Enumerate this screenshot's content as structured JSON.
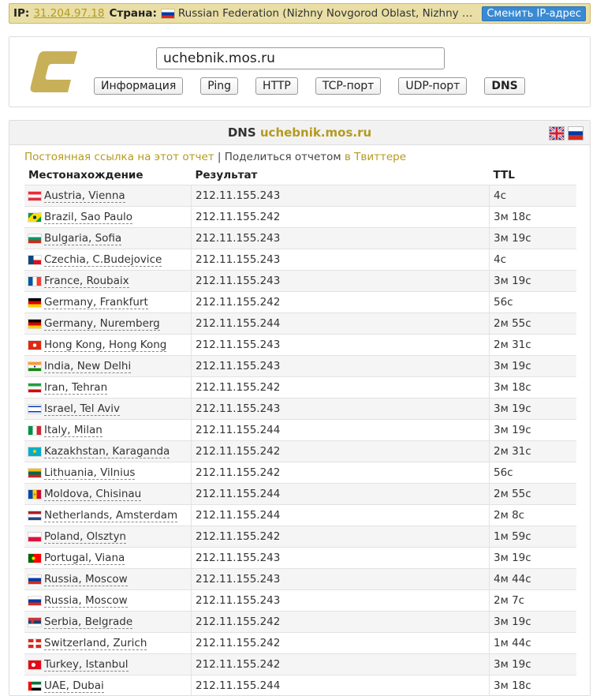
{
  "topbar": {
    "ip_label": "IP:",
    "ip": "31.204.97.18",
    "country_label": "Страна:",
    "country_flag": "ru",
    "location": "Russian Federation (Nizhny Novgorod Oblast, Nizhny Nov...",
    "change_ip_button": "Сменить IP-адрес"
  },
  "search": {
    "host": "uchebnik.mos.ru",
    "tabs": [
      "Информация",
      "Ping",
      "HTTP",
      "TCP-порт",
      "UDP-порт",
      "DNS"
    ],
    "active_tab": "DNS"
  },
  "results": {
    "title_prefix": "DNS",
    "host": "uchebnik.mos.ru",
    "permalink": "Постоянная ссылка на этот отчет",
    "separator": "|",
    "share": "Поделиться отчетом",
    "twitter": "в Твиттере",
    "columns": [
      "Местонахождение",
      "Результат",
      "TTL"
    ],
    "rows": [
      {
        "flag": "at",
        "location": "Austria, Vienna",
        "result": "212.11.155.243",
        "ttl": "4с"
      },
      {
        "flag": "br",
        "location": "Brazil, Sao Paulo",
        "result": "212.11.155.242",
        "ttl": "3м 18с"
      },
      {
        "flag": "bg",
        "location": "Bulgaria, Sofia",
        "result": "212.11.155.243",
        "ttl": "3м 19с"
      },
      {
        "flag": "cz",
        "location": "Czechia, C.Budejovice",
        "result": "212.11.155.243",
        "ttl": "4с"
      },
      {
        "flag": "fr",
        "location": "France, Roubaix",
        "result": "212.11.155.243",
        "ttl": "3м 19с"
      },
      {
        "flag": "de",
        "location": "Germany, Frankfurt",
        "result": "212.11.155.242",
        "ttl": "56с"
      },
      {
        "flag": "de",
        "location": "Germany, Nuremberg",
        "result": "212.11.155.244",
        "ttl": "2м 55с"
      },
      {
        "flag": "hk",
        "location": "Hong Kong, Hong Kong",
        "result": "212.11.155.243",
        "ttl": "2м 31с"
      },
      {
        "flag": "in",
        "location": "India, New Delhi",
        "result": "212.11.155.243",
        "ttl": "3м 19с"
      },
      {
        "flag": "ir",
        "location": "Iran, Tehran",
        "result": "212.11.155.242",
        "ttl": "3м 18с"
      },
      {
        "flag": "il",
        "location": "Israel, Tel Aviv",
        "result": "212.11.155.243",
        "ttl": "3м 19с"
      },
      {
        "flag": "it",
        "location": "Italy, Milan",
        "result": "212.11.155.244",
        "ttl": "3м 19с"
      },
      {
        "flag": "kz",
        "location": "Kazakhstan, Karaganda",
        "result": "212.11.155.242",
        "ttl": "2м 31с"
      },
      {
        "flag": "lt",
        "location": "Lithuania, Vilnius",
        "result": "212.11.155.242",
        "ttl": "56с"
      },
      {
        "flag": "md",
        "location": "Moldova, Chisinau",
        "result": "212.11.155.244",
        "ttl": "2м 55с"
      },
      {
        "flag": "nl",
        "location": "Netherlands, Amsterdam",
        "result": "212.11.155.244",
        "ttl": "2м 8с"
      },
      {
        "flag": "pl",
        "location": "Poland, Olsztyn",
        "result": "212.11.155.242",
        "ttl": "1м 59с"
      },
      {
        "flag": "pt",
        "location": "Portugal, Viana",
        "result": "212.11.155.243",
        "ttl": "3м 19с"
      },
      {
        "flag": "ru",
        "location": "Russia, Moscow",
        "result": "212.11.155.243",
        "ttl": "4м 44с"
      },
      {
        "flag": "ru",
        "location": "Russia, Moscow",
        "result": "212.11.155.243",
        "ttl": "2м 7с"
      },
      {
        "flag": "rs",
        "location": "Serbia, Belgrade",
        "result": "212.11.155.242",
        "ttl": "3м 19с"
      },
      {
        "flag": "ch",
        "location": "Switzerland, Zurich",
        "result": "212.11.155.242",
        "ttl": "1м 44с"
      },
      {
        "flag": "tr",
        "location": "Turkey, Istanbul",
        "result": "212.11.155.242",
        "ttl": "3м 19с"
      },
      {
        "flag": "ae",
        "location": "UAE, Dubai",
        "result": "212.11.155.244",
        "ttl": "3м 18с"
      }
    ]
  }
}
